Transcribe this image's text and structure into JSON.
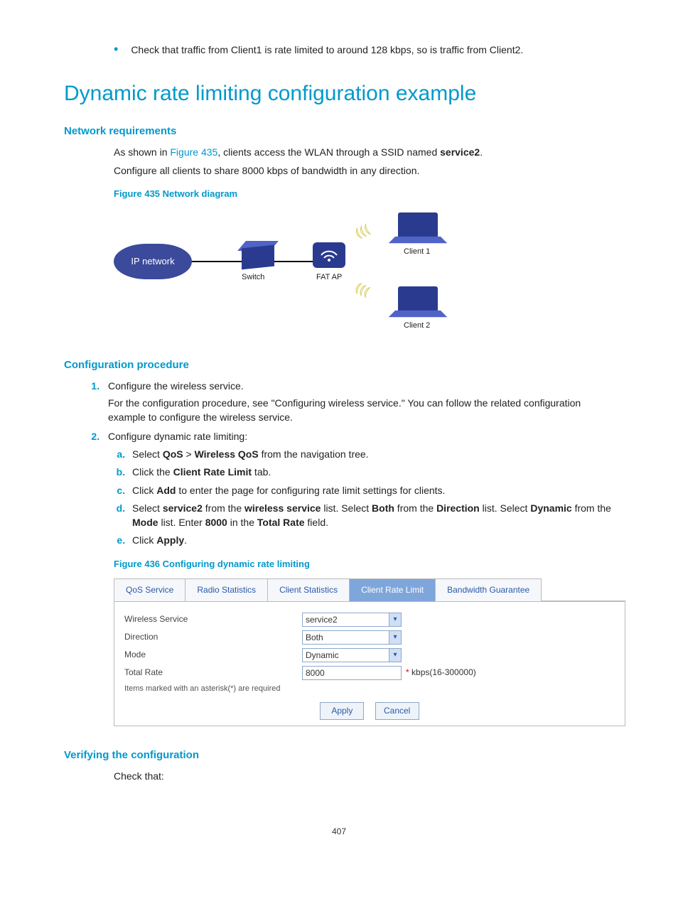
{
  "intro_bullet": "Check that traffic from Client1 is rate limited to around 128 kbps, so is traffic from Client2.",
  "section_title": "Dynamic rate limiting configuration example",
  "network_requirements": {
    "heading": "Network requirements",
    "line1_pre": "As shown in ",
    "line1_link": "Figure 435",
    "line1_mid": ", clients access the WLAN through a SSID named ",
    "line1_bold": "service2",
    "line1_post": ".",
    "line2": "Configure all clients to share 8000 kbps of bandwidth in any direction.",
    "figure_caption": "Figure 435 Network diagram"
  },
  "diagram": {
    "ip_network": "IP network",
    "switch": "Switch",
    "fat_ap": "FAT AP",
    "client1": "Client 1",
    "client2": "Client 2"
  },
  "config_procedure": {
    "heading": "Configuration procedure",
    "step1": "Configure the wireless service.",
    "step1_sub": "For the configuration procedure, see \"Configuring wireless service.\" You can follow the related configuration example to configure the wireless service.",
    "step2": "Configure dynamic rate limiting:",
    "a_pre": "Select ",
    "a_b1": "QoS",
    "a_mid": " > ",
    "a_b2": "Wireless QoS",
    "a_post": " from the navigation tree.",
    "b_pre": "Click the ",
    "b_b1": "Client Rate Limit",
    "b_post": " tab.",
    "c_pre": "Click ",
    "c_b1": "Add",
    "c_post": " to enter the page for configuring rate limit settings for clients.",
    "d_pre": "Select ",
    "d_b1": "service2",
    "d_mid1": " from the ",
    "d_b2": "wireless service",
    "d_mid2": " list. Select ",
    "d_b3": "Both",
    "d_mid3": " from the ",
    "d_b4": "Direction",
    "d_mid4": " list. Select ",
    "d_b5": "Dynamic",
    "d_mid5": " from the ",
    "d_b6": "Mode",
    "d_mid6": " list. Enter ",
    "d_b7": "8000",
    "d_mid7": " in the ",
    "d_b8": "Total Rate",
    "d_post": " field.",
    "e_pre": "Click ",
    "e_b1": "Apply",
    "e_post": ".",
    "figure_caption": "Figure 436 Configuring dynamic rate limiting"
  },
  "ui": {
    "tabs": [
      "QoS Service",
      "Radio Statistics",
      "Client Statistics",
      "Client Rate Limit",
      "Bandwidth Guarantee"
    ],
    "active_tab_index": 3,
    "fields": {
      "wireless_service": {
        "label": "Wireless Service",
        "value": "service2"
      },
      "direction": {
        "label": "Direction",
        "value": "Both"
      },
      "mode": {
        "label": "Mode",
        "value": "Dynamic"
      },
      "total_rate": {
        "label": "Total Rate",
        "value": "8000",
        "hint": "kbps(16-300000)"
      }
    },
    "note": "Items marked with an asterisk(*) are required",
    "apply": "Apply",
    "cancel": "Cancel"
  },
  "verifying": {
    "heading": "Verifying the configuration",
    "line": "Check that:"
  },
  "page_number": "407"
}
